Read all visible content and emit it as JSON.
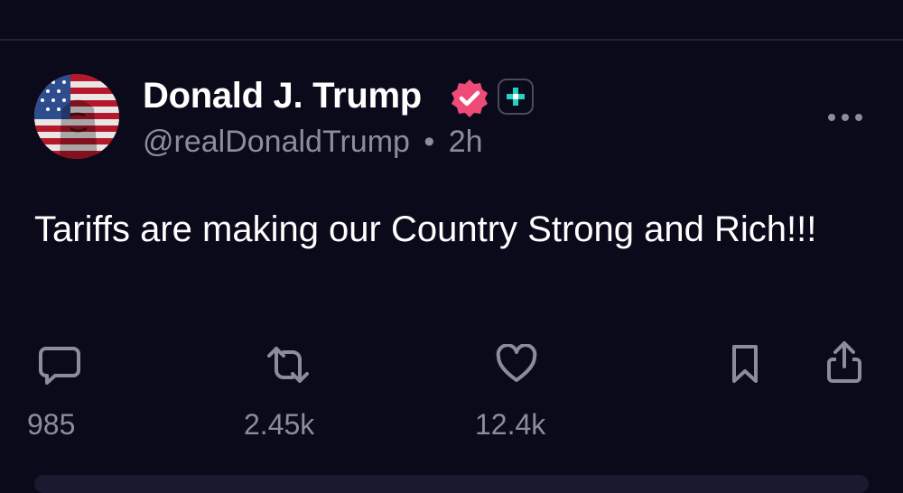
{
  "post": {
    "author_name": "Donald J. Trump",
    "handle": "@realDonaldTrump",
    "separator": "•",
    "time": "2h",
    "text": "Tariffs are making our Country Strong and Rich!!!"
  },
  "actions": {
    "reply": {
      "icon": "comment-icon",
      "count": "985"
    },
    "repost": {
      "icon": "repost-icon",
      "count": "2.45k"
    },
    "like": {
      "icon": "heart-icon",
      "count": "12.4k"
    },
    "bookmark": {
      "icon": "bookmark-icon"
    },
    "share": {
      "icon": "share-icon"
    }
  },
  "colors": {
    "background": "#0b0a1a",
    "verified_badge": "#ee4b78",
    "plus_badge": "#22d3c5",
    "muted_text": "#8d8c99"
  }
}
